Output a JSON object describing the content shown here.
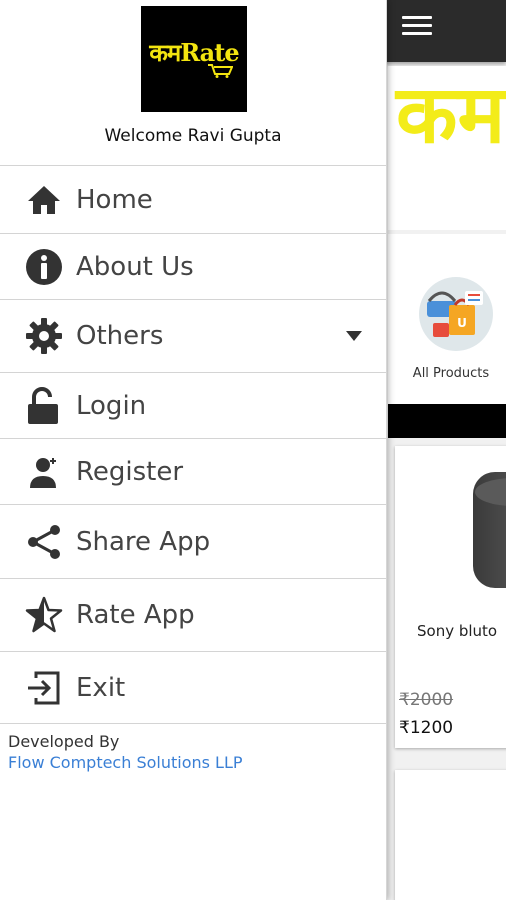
{
  "drawer": {
    "logo_text": "कमRate",
    "welcome": "Welcome Ravi Gupta",
    "items": [
      {
        "label": "Home",
        "icon": "home-icon"
      },
      {
        "label": "About Us",
        "icon": "info-icon"
      },
      {
        "label": "Others",
        "icon": "gear-icon"
      },
      {
        "label": "Login",
        "icon": "unlock-icon"
      },
      {
        "label": "Register",
        "icon": "user-add-icon"
      },
      {
        "label": "Share App",
        "icon": "share-icon"
      },
      {
        "label": "Rate App",
        "icon": "star-icon"
      },
      {
        "label": "Exit",
        "icon": "exit-icon"
      }
    ],
    "footer": {
      "developed_by": "Developed By",
      "company": "Flow Comptech Solutions LLP"
    }
  },
  "app": {
    "banner_text": "कमR",
    "category_label": "All Products",
    "product": {
      "name": "Sony bluto",
      "old_price": "₹2000",
      "new_price": "₹1200"
    }
  },
  "colors": {
    "toolbar": "#2b2b2b",
    "brand_yellow": "#f3e510",
    "link_blue": "#3a7fd5",
    "icon_dark": "#333333"
  }
}
